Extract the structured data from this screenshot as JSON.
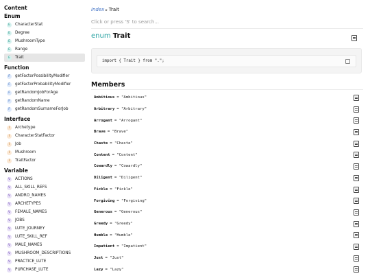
{
  "sidebar": {
    "header": "Content",
    "sections": [
      {
        "title": "Enum",
        "badge": "E",
        "kind": "e",
        "items": [
          "CharacterStat",
          "Degree",
          "MushroomType",
          "Range",
          "Trait"
        ]
      },
      {
        "title": "Function",
        "badge": "F",
        "kind": "f",
        "items": [
          "getFactorPossibilityModifier",
          "getFactorProbabilityModifier",
          "getRandomJobForAge",
          "getRandomName",
          "getRandomSurnameForJob"
        ]
      },
      {
        "title": "Interface",
        "badge": "I",
        "kind": "i",
        "items": [
          "Archetype",
          "CharacterStatFactor",
          "Job",
          "Mushroom",
          "TraitFactor"
        ]
      },
      {
        "title": "Variable",
        "badge": "V",
        "kind": "v",
        "items": [
          "ACTIONS",
          "ALL_SKILL_REFS",
          "ANDRO_NAMES",
          "ARCHETYPES",
          "FEMALE_NAMES",
          "JOBS",
          "LUTE_JOURNEY",
          "LUTE_SKILL_REF",
          "MALE_NAMES",
          "MUSHROOM_DESCRIPTIONS",
          "PRACTICE_LUTE",
          "PURCHASE_LUTE"
        ]
      }
    ],
    "active_item": "Trait"
  },
  "breadcrumb": {
    "link": "index",
    "separator": "▸",
    "current": "Trait"
  },
  "search": {
    "placeholder": "Click or press 'S' to search..."
  },
  "title": {
    "keyword": "enum",
    "name": "Trait"
  },
  "import_code": "import { Trait } from \".\";",
  "members_heading": "Members",
  "members": [
    {
      "name": "Ambitious",
      "value": "= \"Ambitious\""
    },
    {
      "name": "Arbitrary",
      "value": "= \"Arbitrary\""
    },
    {
      "name": "Arrogant",
      "value": "= \"Arrogant\""
    },
    {
      "name": "Brave",
      "value": "= \"Brave\""
    },
    {
      "name": "Chaste",
      "value": "= \"Chaste\""
    },
    {
      "name": "Content",
      "value": "= \"Content\""
    },
    {
      "name": "Cowardly",
      "value": "= \"Cowardly\""
    },
    {
      "name": "Diligent",
      "value": "= \"Diligent\""
    },
    {
      "name": "Fickle",
      "value": "= \"Fickle\""
    },
    {
      "name": "Forgiving",
      "value": "= \"Forgiving\""
    },
    {
      "name": "Generous",
      "value": "= \"Generous\""
    },
    {
      "name": "Greedy",
      "value": "= \"Greedy\""
    },
    {
      "name": "Humble",
      "value": "= \"Humble\""
    },
    {
      "name": "Impatient",
      "value": "= \"Impatient\""
    },
    {
      "name": "Just",
      "value": "= \"Just\""
    },
    {
      "name": "Lazy",
      "value": "= \"Lazy\""
    }
  ],
  "icons": {
    "source": "source-file-icon",
    "copy": "copy-icon"
  },
  "colors": {
    "enum_keyword": "#2ba3a3",
    "link": "#3d6fc4",
    "active_bg": "#e6e6e6"
  }
}
